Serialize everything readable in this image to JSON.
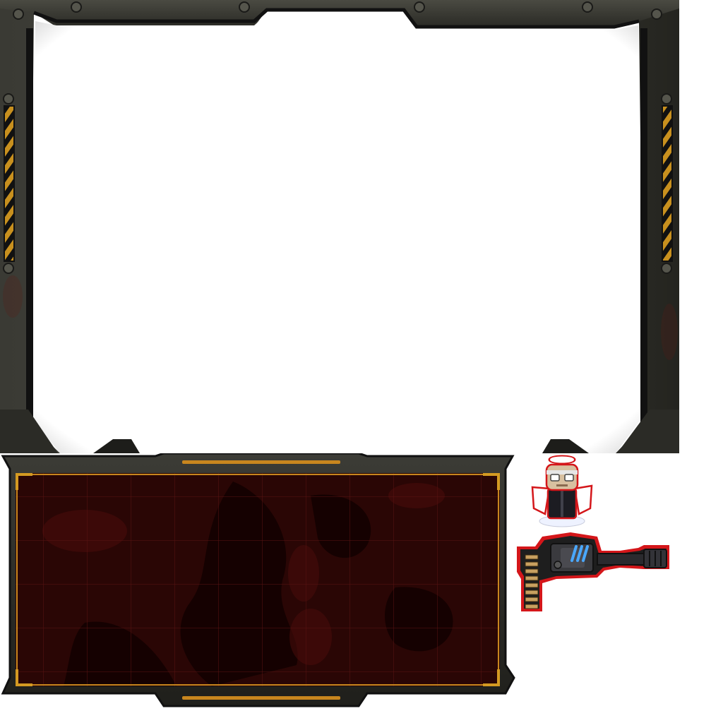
{
  "sprites": {
    "hud_frame": {
      "name": "metal-hud-frame",
      "accent_color": "#d49a22",
      "metal_color": "#2e2e2a"
    },
    "map_panel": {
      "name": "red-map-panel",
      "accent_color": "#c8861e",
      "map_color": "#2a0605",
      "grid_color": "#5a1412"
    },
    "angel": {
      "name": "angel-character-icon",
      "outline_color": "#d4161a"
    },
    "weapon": {
      "name": "minigun-weapon-icon",
      "outline_color": "#d4161a",
      "glow_color": "#4aa8ff"
    }
  }
}
